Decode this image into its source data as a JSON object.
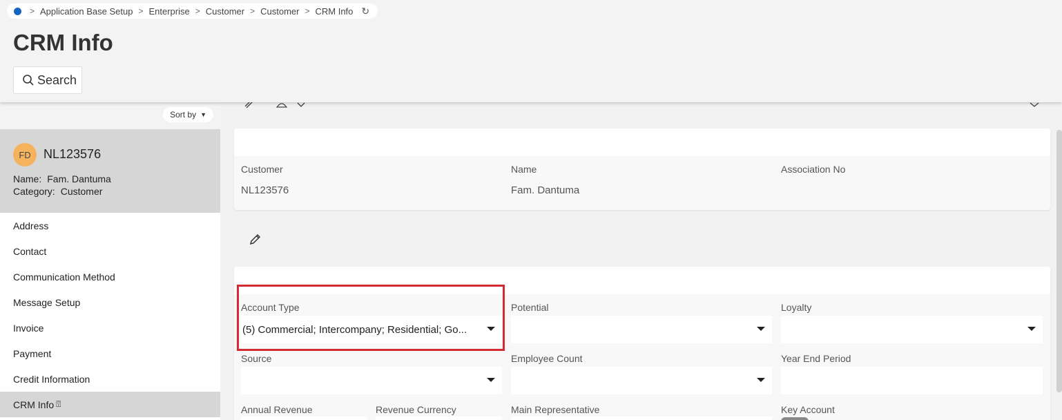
{
  "breadcrumb": {
    "items": [
      "Application Base Setup",
      "Enterprise",
      "Customer",
      "Customer",
      "CRM Info"
    ]
  },
  "page_title": "CRM Info",
  "search_label": "Search",
  "sort_label": "Sort by",
  "record": {
    "avatar_initials": "FD",
    "id": "NL123576",
    "name_label": "Name:",
    "name_value": "Fam. Dantuma",
    "category_label": "Category:",
    "category_value": "Customer"
  },
  "nav": {
    "items": [
      "Address",
      "Contact",
      "Communication Method",
      "Message Setup",
      "Invoice",
      "Payment",
      "Credit Information",
      "CRM Info"
    ],
    "active": "CRM Info"
  },
  "header_card": {
    "customer_label": "Customer",
    "customer_value": "NL123576",
    "name_label": "Name",
    "name_value": "Fam. Dantuma",
    "association_label": "Association No",
    "association_value": ""
  },
  "crm_card": {
    "account_type_label": "Account Type",
    "account_type_value": "(5) Commercial; Intercompany; Residential; Go...",
    "potential_label": "Potential",
    "potential_value": "",
    "loyalty_label": "Loyalty",
    "loyalty_value": "",
    "source_label": "Source",
    "source_value": "",
    "employee_count_label": "Employee Count",
    "employee_count_value": "",
    "year_end_label": "Year End Period",
    "year_end_value": "",
    "annual_revenue_label": "Annual Revenue",
    "revenue_currency_label": "Revenue Currency",
    "main_rep_label": "Main Representative",
    "key_account_label": "Key Account"
  },
  "colors": {
    "accent": "#1565c0",
    "highlight": "#d42a33",
    "avatar": "#f5b35e"
  }
}
